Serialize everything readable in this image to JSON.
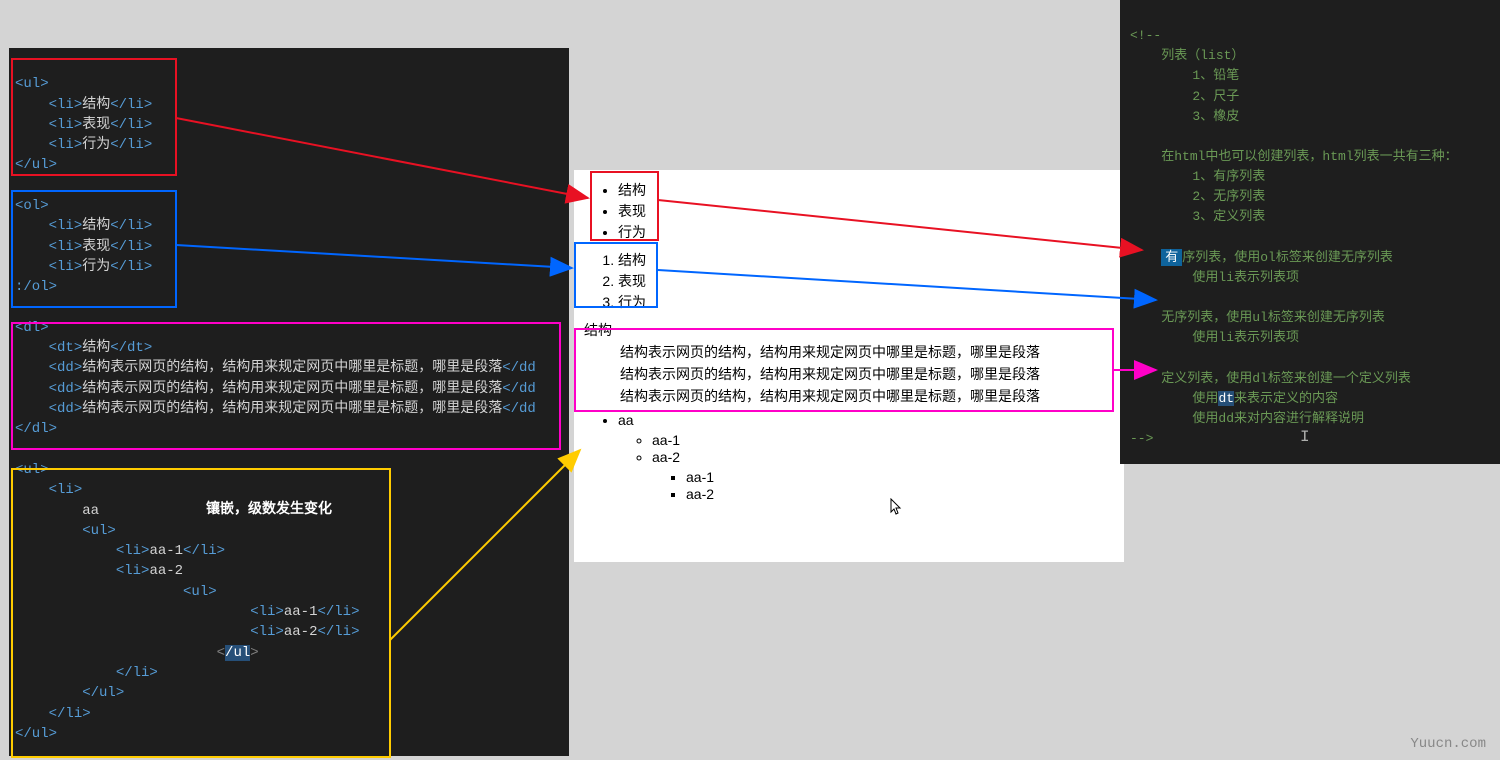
{
  "ul_code": {
    "open": "<ul>",
    "li1_o": "<li>",
    "li1_t": "结构",
    "li1_c": "</li>",
    "li2_o": "<li>",
    "li2_t": "表现",
    "li2_c": "</li>",
    "li3_o": "<li>",
    "li3_t": "行为",
    "li3_c": "</li>",
    "close": "</ul>"
  },
  "ol_code": {
    "open": "<ol>",
    "li1_o": "<li>",
    "li1_t": "结构",
    "li1_c": "</li>",
    "li2_o": "<li>",
    "li2_t": "表现",
    "li2_c": "</li>",
    "li3_o": "<li>",
    "li3_t": "行为",
    "li3_c": "</li>",
    "close": ":/ol>"
  },
  "dl_code": {
    "open": "<dl>",
    "dt_o": "<dt>",
    "dt_t": "结构",
    "dt_c": "</dt>",
    "dd_o": "<dd>",
    "dd_t": "结构表示网页的结构，结构用来规定网页中哪里是标题，哪里是段落",
    "dd_c": "</dd",
    "close": "</dl>"
  },
  "nest_code": {
    "open": "<ul>",
    "li_o": "<li>",
    "aa": "aa",
    "ul2_o": "<ul>",
    "li_a1_o": "<li>",
    "li_a1_t": "aa-1",
    "li_a1_c": "</li>",
    "li_a2_o": "<li>",
    "li_a2_t": "aa-2",
    "ul3_o": "<ul>",
    "li_b1_o": "<li>",
    "li_b1_t": "aa-1",
    "li_b1_c": "</li>",
    "li_b2_o": "<li>",
    "li_b2_t": "aa-2",
    "li_b2_c": "</li>",
    "ul3_c_o": "<",
    "ul3_c_sl": "/ul",
    "ul3_c_c": ">",
    "li_a2_c": "</li>",
    "ul2_c": "</ul>",
    "li_c": "</li>",
    "close": "</ul>"
  },
  "embed_note": "镶嵌，级数发生变化",
  "render": {
    "ul": [
      "结构",
      "表现",
      "行为"
    ],
    "ol": [
      "结构",
      "表现",
      "行为"
    ],
    "dl_dt": "结构",
    "dl_dd": "结构表示网页的结构，结构用来规定网页中哪里是标题，哪里是段落",
    "nest_top": "aa",
    "nest_l2_1": "aa-1",
    "nest_l2_2": "aa-2",
    "nest_l3_1": "aa-1",
    "nest_l3_2": "aa-2"
  },
  "right": {
    "open": "<!--",
    "title": "列表（list）",
    "i1": "1、铅笔",
    "i2": "2、尺子",
    "i3": "3、橡皮",
    "p1": "在html中也可以创建列表，html列表一共有三种：",
    "p1a": "1、有序列表",
    "p1b": "2、无序列表",
    "p1c": "3、定义列表",
    "p2_pre": "有",
    "p2_post": "序列表，使用ol标签来创建无序列表",
    "p2b": "使用li表示列表项",
    "p3": "无序列表，使用ul标签来创建无序列表",
    "p3b": "使用li表示列表项",
    "p4": "定义列表，使用dl标签来创建一个定义列表",
    "p4b_pre": "使用",
    "p4b_sel": "dt",
    "p4b_post": "来表示定义的内容",
    "p4c": "使用dd来对内容进行解释说明",
    "close": "-->"
  },
  "watermark": "Yuucn.com"
}
